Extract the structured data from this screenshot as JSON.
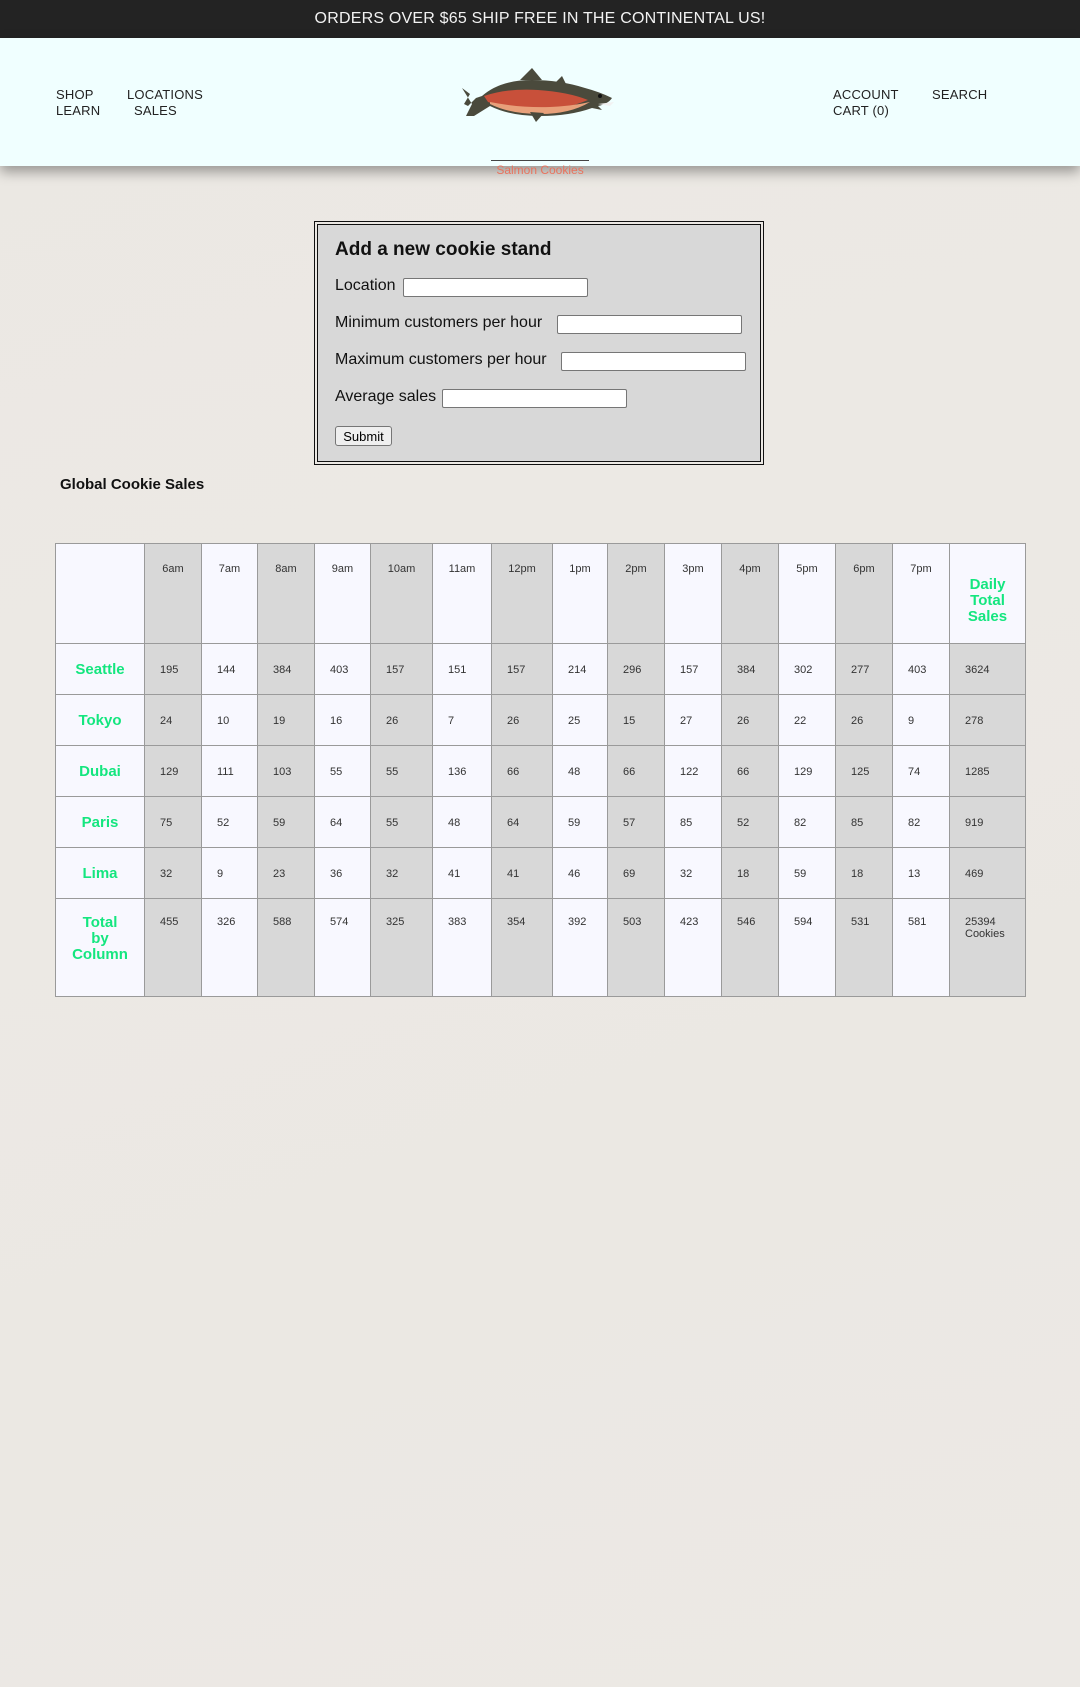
{
  "announcement": "ORDERS OVER $65 SHIP FREE IN THE CONTINENTAL US!",
  "nav": {
    "shop": "SHOP",
    "learn": "LEARN",
    "locations": "LOCATIONS",
    "sales": "SALES",
    "account": "ACCOUNT",
    "cart": "CART (0)",
    "search": "SEARCH"
  },
  "logo": {
    "text": "Salmon Cookies",
    "icon": "salmon-fish-logo"
  },
  "form": {
    "title": "Add a new cookie stand",
    "location_label": "Location",
    "min_label": "Minimum customers per hour",
    "max_label": "Maximum customers per hour",
    "avg_label": "Average sales",
    "location_value": "",
    "min_value": "",
    "max_value": "",
    "avg_value": "",
    "submit_label": "Submit"
  },
  "table": {
    "heading": "Global Cookie Sales",
    "hours": [
      "6am",
      "7am",
      "8am",
      "9am",
      "10am",
      "11am",
      "12pm",
      "1pm",
      "2pm",
      "3pm",
      "4pm",
      "5pm",
      "6pm",
      "7pm"
    ],
    "daily_total_header": [
      "Daily",
      "Total",
      "Sales"
    ],
    "rows": [
      {
        "name": "Seattle",
        "values": [
          "195",
          "144",
          "384",
          "403",
          "157",
          "151",
          "157",
          "214",
          "296",
          "157",
          "384",
          "302",
          "277",
          "403"
        ],
        "total": "3624"
      },
      {
        "name": "Tokyo",
        "values": [
          "24",
          "10",
          "19",
          "16",
          "26",
          "7",
          "26",
          "25",
          "15",
          "27",
          "26",
          "22",
          "26",
          "9"
        ],
        "total": "278"
      },
      {
        "name": "Dubai",
        "values": [
          "129",
          "111",
          "103",
          "55",
          "55",
          "136",
          "66",
          "48",
          "66",
          "122",
          "66",
          "129",
          "125",
          "74"
        ],
        "total": "1285"
      },
      {
        "name": "Paris",
        "values": [
          "75",
          "52",
          "59",
          "64",
          "55",
          "48",
          "64",
          "59",
          "57",
          "85",
          "52",
          "82",
          "85",
          "82"
        ],
        "total": "919"
      },
      {
        "name": "Lima",
        "values": [
          "32",
          "9",
          "23",
          "36",
          "32",
          "41",
          "41",
          "46",
          "69",
          "32",
          "18",
          "59",
          "18",
          "13"
        ],
        "total": "469"
      }
    ],
    "totals_label": [
      "Total",
      "by",
      "Column"
    ],
    "column_totals": [
      "455",
      "326",
      "588",
      "574",
      "325",
      "383",
      "354",
      "392",
      "503",
      "423",
      "546",
      "594",
      "531",
      "581"
    ],
    "grand_total": [
      "25394",
      "Cookies"
    ]
  },
  "colors": {
    "accent_green": "#14e67f",
    "logo_salmon": "#e8735e",
    "header_bg": "#f0ffff",
    "announce_bg": "#232323"
  }
}
